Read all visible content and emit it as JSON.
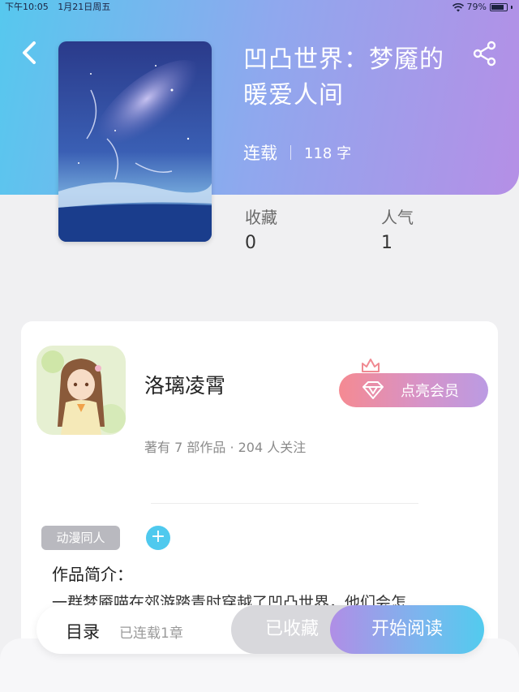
{
  "status_bar": {
    "time": "下午10:05",
    "date": "1月21日周五",
    "battery": "79%"
  },
  "book": {
    "title": "凹凸世界：梦魇的暖爱人间",
    "status": "连载",
    "word_count": "118 字",
    "stats": [
      {
        "label": "收藏",
        "value": "0"
      },
      {
        "label": "人气",
        "value": "1"
      }
    ]
  },
  "author": {
    "name": "洛璃凌霄",
    "stats_text": "著有 7 部作品 · 204 人关注",
    "vip_label": "点亮会员"
  },
  "tags": {
    "items": [
      "动漫同人"
    ],
    "add_symbol": "+"
  },
  "intro": {
    "label": "作品简介：",
    "text": "一群梦魇喵在郊游踏青时穿越了凹凸世界，他们会怎"
  },
  "bottom_bar": {
    "toc_label": "目录",
    "toc_count": "已连载1章",
    "collected_label": "已收藏",
    "read_label": "开始阅读"
  },
  "colors": {
    "header_gradient_start": "#56c8ee",
    "header_gradient_end": "#b58fe6",
    "vip_gradient_start": "#f58a92",
    "vip_gradient_end": "#bb9be3",
    "tag_bg": "#b9b9bf",
    "accent": "#4fc9ee"
  },
  "icons": {
    "back": "back-chevron-icon",
    "share": "share-icon",
    "crown": "crown-icon",
    "gem": "diamond-icon",
    "wifi": "wifi-icon",
    "battery": "battery-icon"
  }
}
